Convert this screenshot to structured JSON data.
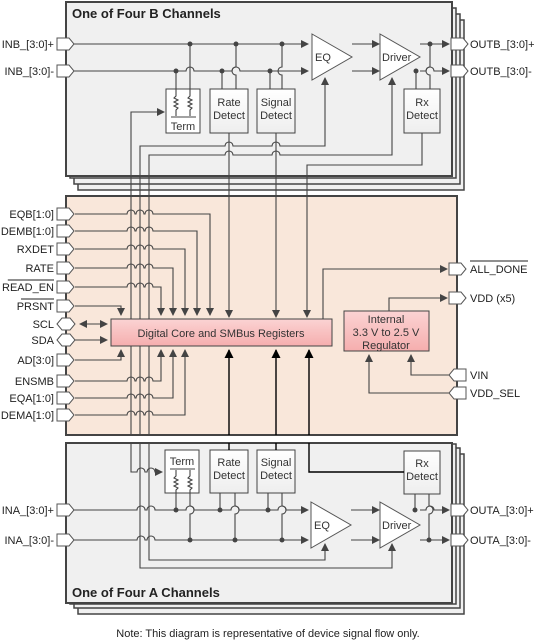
{
  "diagram": {
    "channel_b": {
      "title": "One of Four B Channels",
      "inputs": [
        "INB_[3:0]+",
        "INB_[3:0]-"
      ],
      "outputs": [
        "OUTB_[3:0]+",
        "OUTB_[3:0]-"
      ],
      "blocks": {
        "term": "Term",
        "rate_detect": [
          "Rate",
          "Detect"
        ],
        "signal_detect": [
          "Signal",
          "Detect"
        ],
        "eq": "EQ",
        "driver": "Driver",
        "rx_detect": [
          "Rx",
          "Detect"
        ]
      }
    },
    "core": {
      "left_pins": [
        "EQB[1:0]",
        "DEMB[1:0]",
        "RXDET",
        "RATE",
        "READ_EN",
        "PRSNT",
        "SCL",
        "SDA",
        "AD[3:0]",
        "ENSMB",
        "EQA[1:0]",
        "DEMA[1:0]"
      ],
      "overlined_pins": [
        "READ_EN",
        "PRSNT",
        "ALL_DONE"
      ],
      "digital_core": "Digital Core and SMBus Registers",
      "regulator": [
        "Internal",
        "3.3 V to 2.5 V",
        "Regulator"
      ],
      "right_pins": [
        "ALL_DONE",
        "VDD (x5)",
        "VIN",
        "VDD_SEL"
      ]
    },
    "channel_a": {
      "title": "One of Four A Channels",
      "inputs": [
        "INA_[3:0]+",
        "INA_[3:0]-"
      ],
      "outputs": [
        "OUTA_[3:0]+",
        "OUTA_[3:0]-"
      ],
      "blocks": {
        "term": "Term",
        "rate_detect": [
          "Rate",
          "Detect"
        ],
        "signal_detect": [
          "Signal",
          "Detect"
        ],
        "eq": "EQ",
        "driver": "Driver",
        "rx_detect": [
          "Rx",
          "Detect"
        ]
      }
    },
    "note": "Note: This diagram is representative of device signal flow only.",
    "colors": {
      "channel_fill": "#f0f0f0",
      "core_fill": "#f9e7da",
      "core_block_fill": "#f9c4c4",
      "line": "#444444"
    }
  }
}
